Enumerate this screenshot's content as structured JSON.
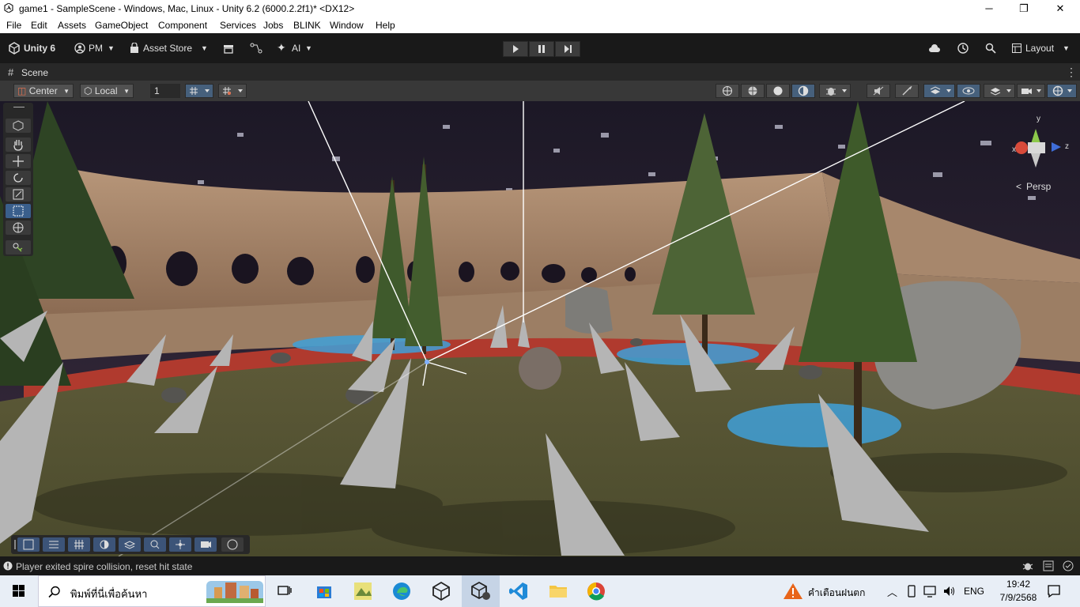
{
  "window": {
    "title": "game1 - SampleScene - Windows, Mac, Linux - Unity 6.2 (6000.2.2f1)* <DX12>",
    "controls": [
      "─",
      "❐",
      "✕"
    ]
  },
  "menu": [
    "File",
    "Edit",
    "Assets",
    "GameObject",
    "Component",
    "Services",
    "Jobs",
    "BLINK",
    "Window",
    "Help"
  ],
  "toolbar": {
    "unity_label": "Unity 6",
    "account_label": "PM",
    "asset_store_label": "Asset Store",
    "ai_label": "AI",
    "layout_label": "Layout"
  },
  "tab": {
    "label": "Scene",
    "menu_glyph": "⋮"
  },
  "scene_toolbar": {
    "pivot_label": "Center",
    "space_label": "Local",
    "snap_value": "1"
  },
  "gizmo": {
    "x": "x",
    "y": "y",
    "z": "z",
    "persp_label": "Persp"
  },
  "status": {
    "message": "Player exited spire collision, reset hit state"
  },
  "taskbar": {
    "search_placeholder": "พิมพ์ที่นี่เพื่อค้นหา",
    "weather_label": "คำเตือนฝนตก",
    "lang": "ENG",
    "time": "19:42",
    "date": "7/9/2568"
  },
  "colors": {
    "accent": "#3a5f8c",
    "toolbar": "#191919",
    "panel": "#383838"
  }
}
